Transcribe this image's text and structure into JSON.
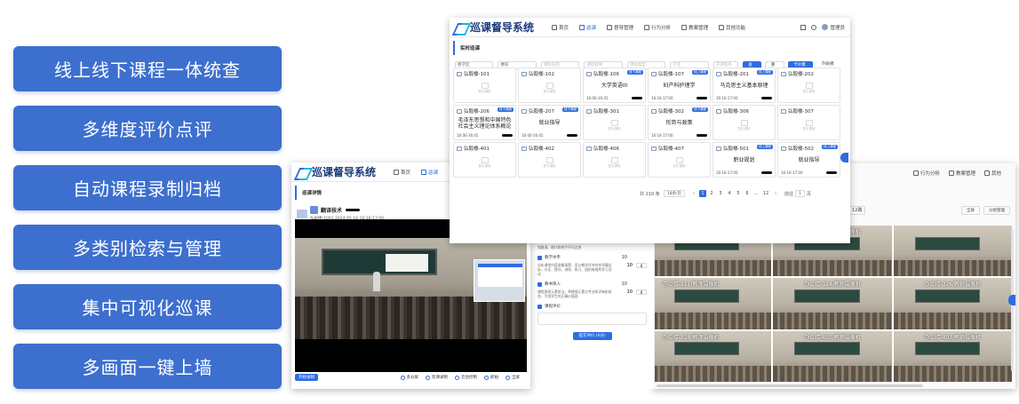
{
  "features": [
    "线上线下课程一体统查",
    "多维度评价点评",
    "自动课程录制归档",
    "多类别检索与管理",
    "集中可视化巡课",
    "多画面一键上墙"
  ],
  "brand": {
    "name": "巡课督导系统",
    "accent": "#2f6ce0",
    "feature_bg": "#3d6fce"
  },
  "main_window": {
    "nav": [
      "首页",
      "巡课",
      "督导管理",
      "行为分析",
      "教案管理",
      "其他功能"
    ],
    "user": "管理员",
    "section_title": "实时巡课",
    "filters": [
      "教学区",
      "楼栋",
      "课程名称",
      "课程教师",
      "课程类型",
      "学年",
      "开课院系",
      "课程教师"
    ],
    "search_btn": "查询",
    "reset_btn": "重置",
    "view_toggle": [
      "卡片模式",
      "列表模式"
    ],
    "rooms": [
      {
        "name": "弘毅楼-101",
        "course": "",
        "time": "",
        "tag": "",
        "empty_text": "暂无课程"
      },
      {
        "name": "弘毅楼-102",
        "course": "",
        "time": "",
        "tag": "",
        "empty_text": "暂无课程"
      },
      {
        "name": "弘毅楼-106",
        "course": "大学英语III",
        "time": "16:00-16:45",
        "tag": "线下课程",
        "empty_text": ""
      },
      {
        "name": "弘毅楼-107",
        "course": "妇产科护理学",
        "time": "16:16-17:00",
        "tag": "线上课程",
        "empty_text": ""
      },
      {
        "name": "弘毅楼-201",
        "course": "马克思主义基本原理",
        "time": "16:16-17:00",
        "tag": "线上课程",
        "empty_text": ""
      },
      {
        "name": "弘毅楼-202",
        "course": "",
        "time": "",
        "tag": "",
        "empty_text": "暂无课程"
      },
      {
        "name": "弘毅楼-206",
        "course": "毛泽东思想和中国特色社会主义理论体系概论",
        "time": "16:00-16:45",
        "tag": "线下课程",
        "empty_text": ""
      },
      {
        "name": "弘毅楼-207",
        "course": "就业指导",
        "time": "16:00-16:45",
        "tag": "线下课程",
        "empty_text": ""
      },
      {
        "name": "弘毅楼-301",
        "course": "",
        "time": "",
        "tag": "",
        "empty_text": "暂无课程"
      },
      {
        "name": "弘毅楼-302",
        "course": "形势与政策",
        "time": "16:16-17:00",
        "tag": "线下课程",
        "empty_text": ""
      },
      {
        "name": "弘毅楼-306",
        "course": "",
        "time": "",
        "tag": "",
        "empty_text": "暂无课程"
      },
      {
        "name": "弘毅楼-307",
        "course": "",
        "time": "",
        "tag": "",
        "empty_text": "暂无课程"
      },
      {
        "name": "弘毅楼-401",
        "course": "",
        "time": "",
        "tag": "",
        "empty_text": "暂无课程"
      },
      {
        "name": "弘毅楼-402",
        "course": "",
        "time": "",
        "tag": "",
        "empty_text": "暂无课程"
      },
      {
        "name": "弘毅楼-406",
        "course": "",
        "time": "",
        "tag": "",
        "empty_text": "暂无课程"
      },
      {
        "name": "弘毅楼-407",
        "course": "",
        "time": "",
        "tag": "",
        "empty_text": "暂无课程"
      },
      {
        "name": "弘毅楼-501",
        "course": "职业规划",
        "time": "16:16-17:00",
        "tag": "线上课程",
        "empty_text": ""
      },
      {
        "name": "弘毅楼-502",
        "course": "就业指导",
        "time": "16:16-17:00",
        "tag": "线上课程",
        "empty_text": ""
      }
    ],
    "pager": {
      "total": "共 210 条",
      "page_size": "18条/页",
      "pages": [
        "1",
        "2",
        "3",
        "4",
        "5",
        "6",
        "...",
        "12"
      ],
      "goto_label": "前往",
      "goto_value": "1",
      "goto_suffix": "页"
    }
  },
  "detail_window": {
    "nav": [
      "首页",
      "巡课"
    ],
    "section_title": "巡课详情",
    "course_title": "翻译技术",
    "meta": "弘毅楼-1001  2024-05-16 16:16-17:00",
    "tools": [
      "开始录制",
      "多分屏",
      "巡课录制",
      "云台控制",
      "抓拍",
      "全屏"
    ]
  },
  "eval_panel": {
    "intro": "思路清，图片和例子不可过多",
    "items": [
      {
        "label": "教学水平",
        "score": "10",
        "desc": "分析课堂内容讲解清楚，设计教学环节符合学情实际，讨论、提问、讲授、练习、组织有效的学习活动",
        "input": "0"
      },
      {
        "label": "教书育人",
        "score": "10",
        "desc": "课程思政元素恰当，将德育元素与专业知识有机结合，引领学生的正确价值观",
        "input": "0"
      }
    ],
    "comment_label": "课程评价",
    "submit": "提交评价 (0分)"
  },
  "wall_window": {
    "nav": [
      "行为分析",
      "教案管理",
      "其他"
    ],
    "grid_select": "12路",
    "fullscreen_btn": "全屏",
    "split_btn": "分组管理",
    "cams": [
      "",
      "办公楼-111/教师摄像机",
      "",
      "办公楼-311/教师摄像机",
      "办公楼-324/教师摄像机",
      "办公楼-326/教师摄像机",
      "办公楼-328/教师摄像机",
      "办公楼-401/教师摄像机",
      "办公楼-402/教师摄像机"
    ]
  }
}
